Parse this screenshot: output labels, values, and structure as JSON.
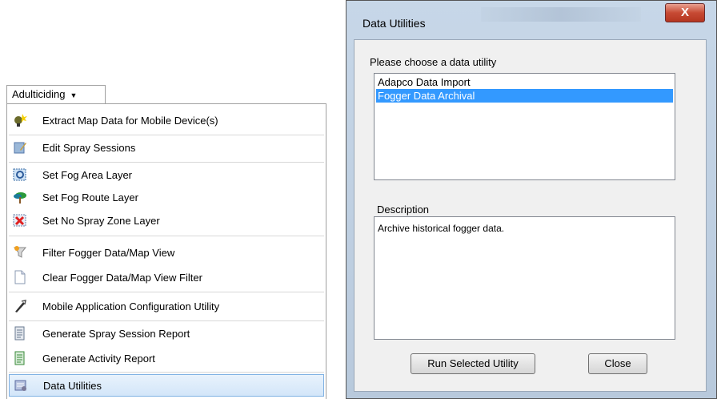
{
  "menu": {
    "title": "Adulticiding",
    "items": [
      {
        "label": "Extract Map Data for Mobile Device(s)",
        "icon": "extract-map-icon"
      },
      {
        "label": "Edit Spray Sessions",
        "icon": "edit-sessions-icon"
      },
      {
        "label": "Set Fog Area Layer",
        "icon": "fog-area-icon"
      },
      {
        "label": "Set Fog Route Layer",
        "icon": "fog-route-icon"
      },
      {
        "label": "Set No Spray Zone Layer",
        "icon": "no-spray-icon"
      },
      {
        "label": "Filter Fogger Data/Map View",
        "icon": "filter-icon"
      },
      {
        "label": "Clear Fogger Data/Map View Filter",
        "icon": "clear-filter-icon"
      },
      {
        "label": "Mobile Application Configuration Utility",
        "icon": "config-icon"
      },
      {
        "label": "Generate Spray Session Report",
        "icon": "report-icon"
      },
      {
        "label": "Generate Activity Report",
        "icon": "activity-report-icon"
      },
      {
        "label": "Data Utilities",
        "icon": "data-utilities-icon"
      }
    ]
  },
  "dialog": {
    "title": "Data Utilities",
    "close_glyph": "X",
    "choose_label": "Please choose a data utility",
    "utilities": [
      "Adapco Data Import",
      "Fogger Data Archival"
    ],
    "selected_utility": "Fogger Data Archival",
    "description_label": "Description",
    "description": "Archive historical fogger data.",
    "run_button": "Run Selected Utility",
    "close_button": "Close"
  },
  "colors": {
    "selection": "#3399ff",
    "menu_highlight": "#d3e6f9",
    "dialog_frame": "#b8c9dc"
  }
}
